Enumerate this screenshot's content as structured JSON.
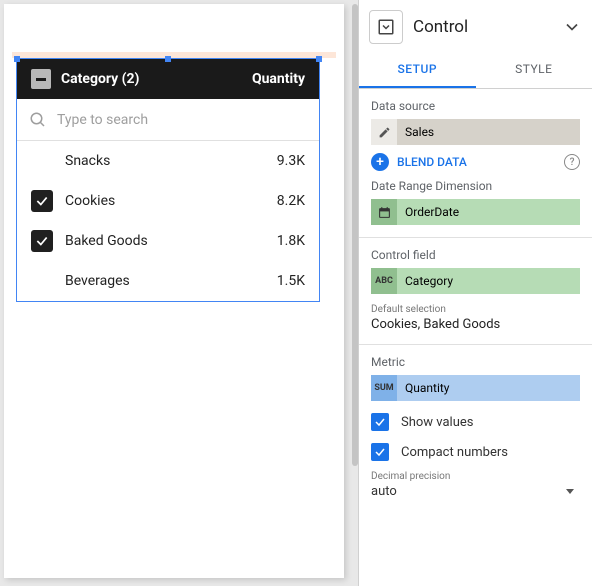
{
  "widget": {
    "header_col1": "Category (2)",
    "header_col2": "Quantity",
    "search_placeholder": "Type to search",
    "rows": [
      {
        "label": "Snacks",
        "value": "9.3K",
        "checked": false
      },
      {
        "label": "Cookies",
        "value": "8.2K",
        "checked": true
      },
      {
        "label": "Baked Goods",
        "value": "1.8K",
        "checked": true
      },
      {
        "label": "Beverages",
        "value": "1.5K",
        "checked": false
      }
    ]
  },
  "panel": {
    "title": "Control",
    "tabs": {
      "setup": "SETUP",
      "style": "STYLE"
    },
    "data_source_label": "Data source",
    "data_source_value": "Sales",
    "blend_label": "BLEND DATA",
    "date_range_label": "Date Range Dimension",
    "date_range_value": "OrderDate",
    "control_field_label": "Control field",
    "control_field_value": "Category",
    "default_selection_label": "Default selection",
    "default_selection_value": "Cookies, Baked Goods",
    "metric_label": "Metric",
    "metric_value": "Quantity",
    "show_values_label": "Show values",
    "compact_label": "Compact numbers",
    "precision_label": "Decimal precision",
    "precision_value": "auto",
    "icon_badges": {
      "abc": "ABC",
      "sum": "SUM"
    }
  }
}
